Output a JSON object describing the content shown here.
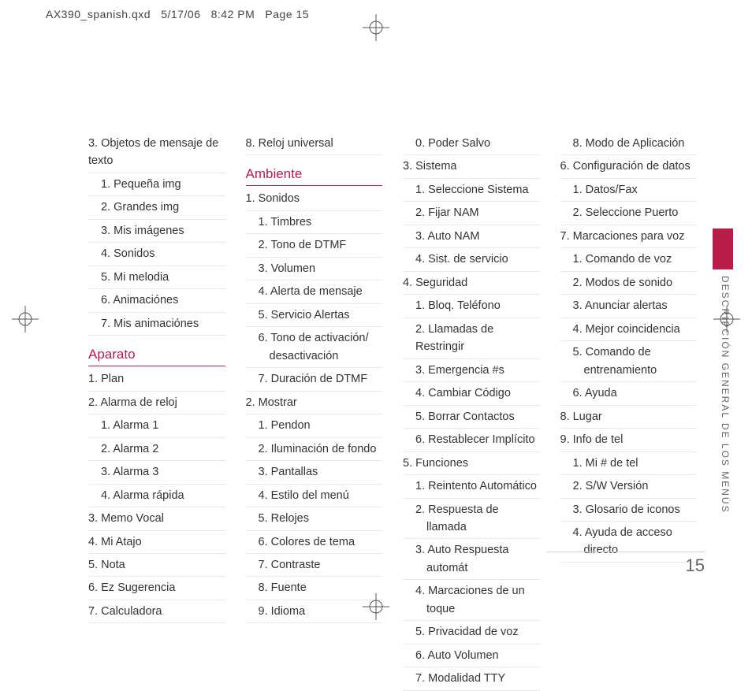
{
  "header": {
    "file": "AX390_spanish.qxd",
    "date": "5/17/06",
    "time": "8:42 PM",
    "label": "Page 15"
  },
  "side_title": "DESCRIPCIÓN GENERAL DE LOS MENÚS",
  "page_number": "15",
  "col1": {
    "a": [
      {
        "t": "3. Objetos de mensaje de texto",
        "s": 0
      },
      {
        "t": "1. Pequeña img",
        "s": 1
      },
      {
        "t": "2. Grandes img",
        "s": 1
      },
      {
        "t": "3. Mis imágenes",
        "s": 1
      },
      {
        "t": "4. Sonidos",
        "s": 1
      },
      {
        "t": "5. Mi melodia",
        "s": 1
      },
      {
        "t": "6. Animaciónes",
        "s": 1
      },
      {
        "t": "7. Mis animaciónes",
        "s": 1
      }
    ],
    "h1": "Aparato",
    "b": [
      {
        "t": "1. Plan",
        "s": 0
      },
      {
        "t": "2. Alarma de reloj",
        "s": 0
      },
      {
        "t": "1. Alarma 1",
        "s": 1
      },
      {
        "t": "2. Alarma 2",
        "s": 1
      },
      {
        "t": "3. Alarma 3",
        "s": 1
      },
      {
        "t": "4. Alarma rápida",
        "s": 1
      },
      {
        "t": "3. Memo Vocal",
        "s": 0
      },
      {
        "t": "4. Mi Atajo",
        "s": 0
      },
      {
        "t": "5. Nota",
        "s": 0
      },
      {
        "t": "6. Ez Sugerencia",
        "s": 0
      },
      {
        "t": "7. Calculadora",
        "s": 0
      }
    ]
  },
  "col2": {
    "a": [
      {
        "t": "8. Reloj universal",
        "s": 0
      }
    ],
    "h1": "Ambiente",
    "b": [
      {
        "t": "1. Sonidos",
        "s": 0
      },
      {
        "t": "1. Timbres",
        "s": 1
      },
      {
        "t": "2. Tono de DTMF",
        "s": 1
      },
      {
        "t": "3. Volumen",
        "s": 1
      },
      {
        "t": "4. Alerta de mensaje",
        "s": 1
      },
      {
        "t": "5. Servicio Alertas",
        "s": 1
      },
      {
        "t": "6. Tono de activación/ desactivación",
        "s": 2
      },
      {
        "t": "7. Duración de DTMF",
        "s": 1
      },
      {
        "t": "2. Mostrar",
        "s": 0
      },
      {
        "t": "1. Pendon",
        "s": 1
      },
      {
        "t": "2. Iluminación de fondo",
        "s": 1
      },
      {
        "t": "3. Pantallas",
        "s": 1
      },
      {
        "t": "4. Estilo del menú",
        "s": 1
      },
      {
        "t": "5. Relojes",
        "s": 1
      },
      {
        "t": "6. Colores de tema",
        "s": 1
      },
      {
        "t": "7. Contraste",
        "s": 1
      },
      {
        "t": "8. Fuente",
        "s": 1
      },
      {
        "t": "9. Idioma",
        "s": 1
      }
    ]
  },
  "col3": {
    "a": [
      {
        "t": "0. Poder Salvo",
        "s": 1
      },
      {
        "t": "3. Sistema",
        "s": 0
      },
      {
        "t": "1. Seleccione Sistema",
        "s": 1
      },
      {
        "t": "2. Fijar NAM",
        "s": 1
      },
      {
        "t": "3. Auto NAM",
        "s": 1
      },
      {
        "t": "4. Sist. de servicio",
        "s": 1
      },
      {
        "t": "4. Seguridad",
        "s": 0
      },
      {
        "t": "1. Bloq. Teléfono",
        "s": 1
      },
      {
        "t": "2. Llamadas de Restringir",
        "s": 1
      },
      {
        "t": "3. Emergencia #s",
        "s": 1
      },
      {
        "t": "4. Cambiar Código",
        "s": 1
      },
      {
        "t": "5. Borrar Contactos",
        "s": 1
      },
      {
        "t": "6. Restablecer Implícito",
        "s": 1
      },
      {
        "t": "5. Funciones",
        "s": 0
      },
      {
        "t": "1. Reintento Automático",
        "s": 1
      },
      {
        "t": "2. Respuesta de llamada",
        "s": 2
      },
      {
        "t": "3. Auto Respuesta automát",
        "s": 2
      },
      {
        "t": "4. Marcaciones de un toque",
        "s": 2
      },
      {
        "t": "5. Privacidad de voz",
        "s": 1
      },
      {
        "t": "6. Auto Volumen",
        "s": 1
      },
      {
        "t": "7. Modalidad TTY",
        "s": 1
      }
    ]
  },
  "col4": {
    "a": [
      {
        "t": "8. Modo de Aplicación",
        "s": 1
      },
      {
        "t": "6. Configuración de datos",
        "s": 0
      },
      {
        "t": "1. Datos/Fax",
        "s": 1
      },
      {
        "t": "2. Seleccione Puerto",
        "s": 1
      },
      {
        "t": "7. Marcaciones para voz",
        "s": 0
      },
      {
        "t": "1. Comando de voz",
        "s": 1
      },
      {
        "t": "2. Modos de sonido",
        "s": 1
      },
      {
        "t": "3. Anunciar alertas",
        "s": 1
      },
      {
        "t": "4. Mejor coincidencia",
        "s": 1
      },
      {
        "t": "5. Comando de entrenamiento",
        "s": 2
      },
      {
        "t": "6. Ayuda",
        "s": 1
      },
      {
        "t": "8. Lugar",
        "s": 0
      },
      {
        "t": "9. Info de tel",
        "s": 0
      },
      {
        "t": "1. Mi # de tel",
        "s": 1
      },
      {
        "t": "2. S/W Versión",
        "s": 1
      },
      {
        "t": "3. Glosario de iconos",
        "s": 1
      },
      {
        "t": "4. Ayuda de acceso directo",
        "s": 2
      }
    ]
  }
}
